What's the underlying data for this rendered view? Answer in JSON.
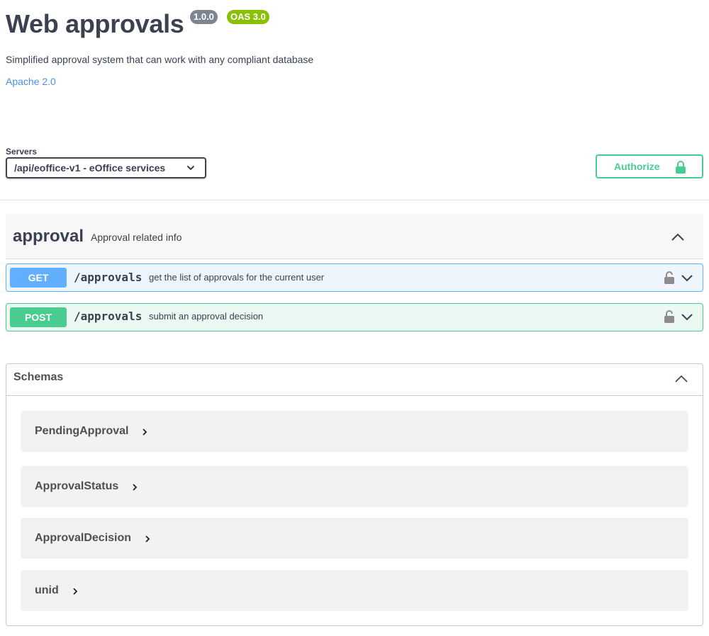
{
  "info": {
    "title": "Web approvals",
    "version_badge": "1.0.0",
    "oas_badge": "OAS 3.0",
    "description": "Simplified approval system that can work with any compliant database",
    "license_link": "Apache 2.0"
  },
  "servers": {
    "label": "Servers",
    "selected": "/api/eoffice-v1 - eOffice services"
  },
  "authorize": {
    "label": "Authorize"
  },
  "tag": {
    "name": "approval",
    "description": "Approval related info"
  },
  "operations": [
    {
      "method": "GET",
      "path": "/approvals",
      "summary": "get the list of approvals for the current user"
    },
    {
      "method": "POST",
      "path": "/approvals",
      "summary": "submit an approval decision"
    }
  ],
  "schemas": {
    "title": "Schemas",
    "models": [
      "PendingApproval",
      "ApprovalStatus",
      "ApprovalDecision",
      "unid"
    ]
  },
  "colors": {
    "get": "#61affe",
    "post": "#49cc90",
    "link": "#4990e2",
    "oas_badge": "#89bf04",
    "version_badge": "#7d8492"
  },
  "icons": {
    "server_dropdown": "chevron-down-icon",
    "authorize": "lock-icon",
    "operation_lock": "lock-icon",
    "operation_expand": "chevron-down-icon",
    "section_collapse": "chevron-up-icon",
    "model_expand": "chevron-right-icon"
  }
}
